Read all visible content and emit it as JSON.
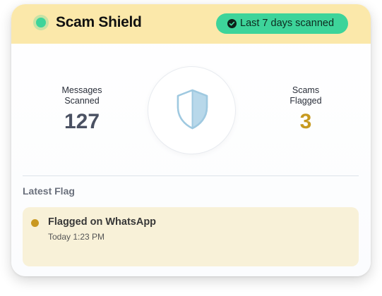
{
  "header": {
    "title": "Scam Shield",
    "badge_label": "Last 7 days scanned",
    "badge_icon": "check-circle-icon",
    "status_icon": "status-dot-icon",
    "bg_color": "#fbe8aa",
    "accent_color": "#3dd49a"
  },
  "stats": {
    "messages_label": "Messages Scanned",
    "messages_value": "127",
    "scams_label": "Scams Flagged",
    "scams_value": "3",
    "center_icon": "shield-icon"
  },
  "latest": {
    "section_title": "Latest Flag",
    "flag_title": "Flagged on WhatsApp",
    "flag_time": "Today 1:23 PM",
    "flag_color": "#c99821"
  }
}
